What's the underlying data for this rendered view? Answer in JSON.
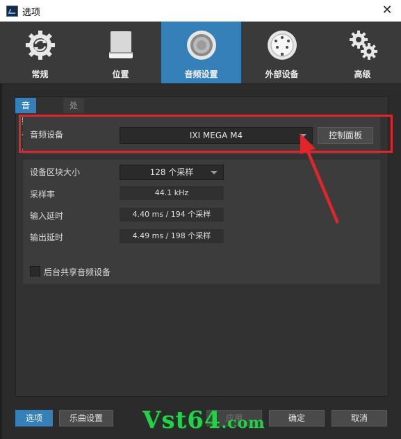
{
  "window": {
    "title": "选项",
    "close_glyph": "✕"
  },
  "toolbar": {
    "items": [
      {
        "label": "常规",
        "icon": "gear-arrows-icon"
      },
      {
        "label": "位置",
        "icon": "drive-icon"
      },
      {
        "label": "音频设置",
        "icon": "speaker-icon",
        "active": true
      },
      {
        "label": "外部设备",
        "icon": "midi-port-icon"
      },
      {
        "label": "高级",
        "icon": "gears-icon"
      }
    ]
  },
  "tabs": {
    "audio_device": "音频设备",
    "processing": "处理中"
  },
  "audio": {
    "device_label": "音频设备",
    "device_value": "IXI MEGA M4",
    "control_panel_label": "控制面板",
    "block_size_label": "设备区块大小",
    "block_size_value": "128 个采样",
    "sample_rate_label": "采样率",
    "sample_rate_value": "44.1 kHz",
    "input_latency_label": "输入延时",
    "input_latency_value": "4.40 ms / 194 个采样",
    "output_latency_label": "输出延时",
    "output_latency_value": "4.49 ms / 198 个采样",
    "background_share_label": "后台共享音频设备"
  },
  "footer": {
    "options": "选项",
    "song_settings": "乐曲设置",
    "apply": "应用",
    "ok": "确定",
    "cancel": "取消"
  },
  "watermark": {
    "main": "Vst64",
    "suffix": ".com"
  },
  "colors": {
    "accent": "#3680b9",
    "highlight": "#e0262a",
    "watermark": "#27d04a"
  }
}
